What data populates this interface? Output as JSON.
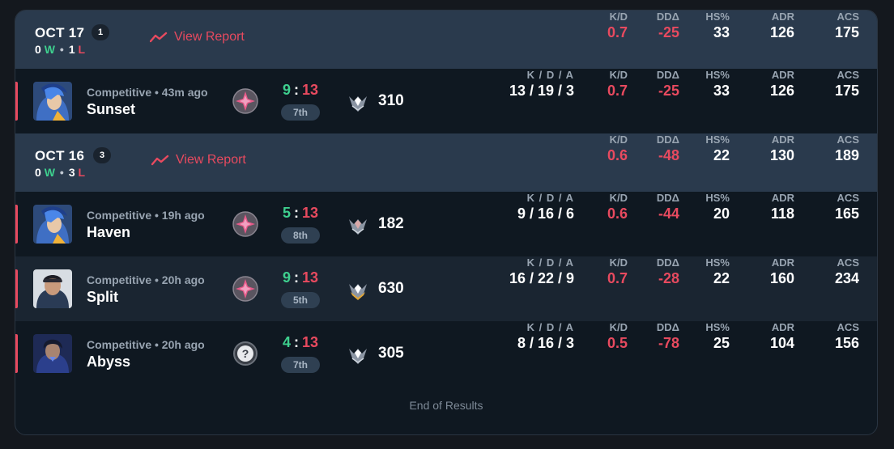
{
  "stat_labels": {
    "kd": "K/D",
    "dd": "DDΔ",
    "hs": "HS%",
    "adr": "ADR",
    "acs": "ACS",
    "kda": "K / D / A"
  },
  "colors": {
    "win": "#3ecf8e",
    "loss": "#e84a5f",
    "header_bg": "#2a3a4d",
    "panel_bg": "#0f1821"
  },
  "groups": [
    {
      "date": "OCT 17",
      "count": "1",
      "wins": "0",
      "w": "W",
      "losses": "1",
      "l": "L",
      "sep": "•",
      "report": "View Report",
      "kd": "0.7",
      "dd": "-25",
      "hs": "33",
      "adr": "126",
      "acs": "175",
      "matches": [
        {
          "mode": "Competitive • 43m ago",
          "map": "Sunset",
          "won": "9",
          "lost": "13",
          "colon": ":",
          "place": "7th",
          "rr": "310",
          "kda": "13 / 19 / 3",
          "kd": "0.7",
          "dd": "-25",
          "hs": "33",
          "adr": "126",
          "acs": "175"
        }
      ]
    },
    {
      "date": "OCT 16",
      "count": "3",
      "wins": "0",
      "w": "W",
      "losses": "3",
      "l": "L",
      "sep": "•",
      "report": "View Report",
      "kd": "0.6",
      "dd": "-48",
      "hs": "22",
      "adr": "130",
      "acs": "189",
      "matches": [
        {
          "mode": "Competitive • 19h ago",
          "map": "Haven",
          "won": "5",
          "lost": "13",
          "colon": ":",
          "place": "8th",
          "rr": "182",
          "kda": "9 / 16 / 6",
          "kd": "0.6",
          "dd": "-44",
          "hs": "20",
          "adr": "118",
          "acs": "165"
        },
        {
          "mode": "Competitive • 20h ago",
          "map": "Split",
          "won": "9",
          "lost": "13",
          "colon": ":",
          "place": "5th",
          "rr": "630",
          "kda": "16 / 22 / 9",
          "kd": "0.7",
          "dd": "-28",
          "hs": "22",
          "adr": "160",
          "acs": "234"
        },
        {
          "mode": "Competitive • 20h ago",
          "map": "Abyss",
          "won": "4",
          "lost": "13",
          "colon": ":",
          "place": "7th",
          "rr": "305",
          "kda": "8 / 16 / 3",
          "kd": "0.5",
          "dd": "-78",
          "hs": "25",
          "adr": "104",
          "acs": "156"
        }
      ]
    }
  ],
  "end_text": "End of Results"
}
